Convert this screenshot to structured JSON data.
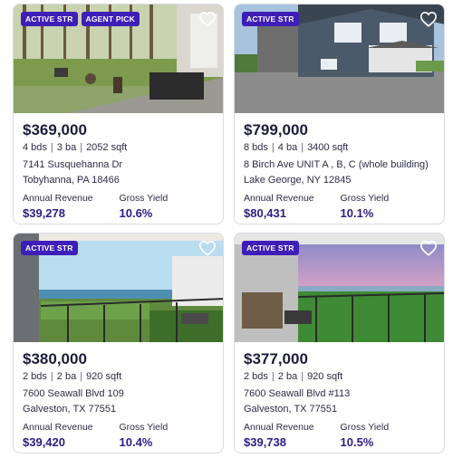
{
  "listings": [
    {
      "badges": [
        "ACTIVE STR",
        "AGENT PICK"
      ],
      "price": "$369,000",
      "beds": "4 bds",
      "baths": "3 ba",
      "sqft": "2052 sqft",
      "address_line1": "7141 Susquehanna Dr",
      "address_line2": "Tobyhanna, PA 18466",
      "revenue_label": "Annual Revenue",
      "revenue": "$39,278",
      "yield_label": "Gross Yield",
      "yield": "10.6%"
    },
    {
      "badges": [
        "ACTIVE STR"
      ],
      "price": "$799,000",
      "beds": "8 bds",
      "baths": "4 ba",
      "sqft": "3400 sqft",
      "address_line1": "8 Birch Ave UNIT A , B, C (whole building)",
      "address_line2": "Lake George, NY 12845",
      "revenue_label": "Annual Revenue",
      "revenue": "$80,431",
      "yield_label": "Gross Yield",
      "yield": "10.1%"
    },
    {
      "badges": [
        "ACTIVE STR"
      ],
      "price": "$380,000",
      "beds": "2 bds",
      "baths": "2 ba",
      "sqft": "920 sqft",
      "address_line1": "7600 Seawall Blvd 109",
      "address_line2": "Galveston, TX 77551",
      "revenue_label": "Annual Revenue",
      "revenue": "$39,420",
      "yield_label": "Gross Yield",
      "yield": "10.4%"
    },
    {
      "badges": [
        "ACTIVE STR"
      ],
      "price": "$377,000",
      "beds": "2 bds",
      "baths": "2 ba",
      "sqft": "920 sqft",
      "address_line1": "7600 Seawall Blvd #113",
      "address_line2": "Galveston, TX 77551",
      "revenue_label": "Annual Revenue",
      "revenue": "$39,738",
      "yield_label": "Gross Yield",
      "yield": "10.5%"
    }
  ],
  "icons": {
    "favorite": "heart-outline-icon"
  },
  "colors": {
    "badge": "#3d1fb8",
    "metric_value": "#2a1d86",
    "price": "#1c1c3a"
  }
}
